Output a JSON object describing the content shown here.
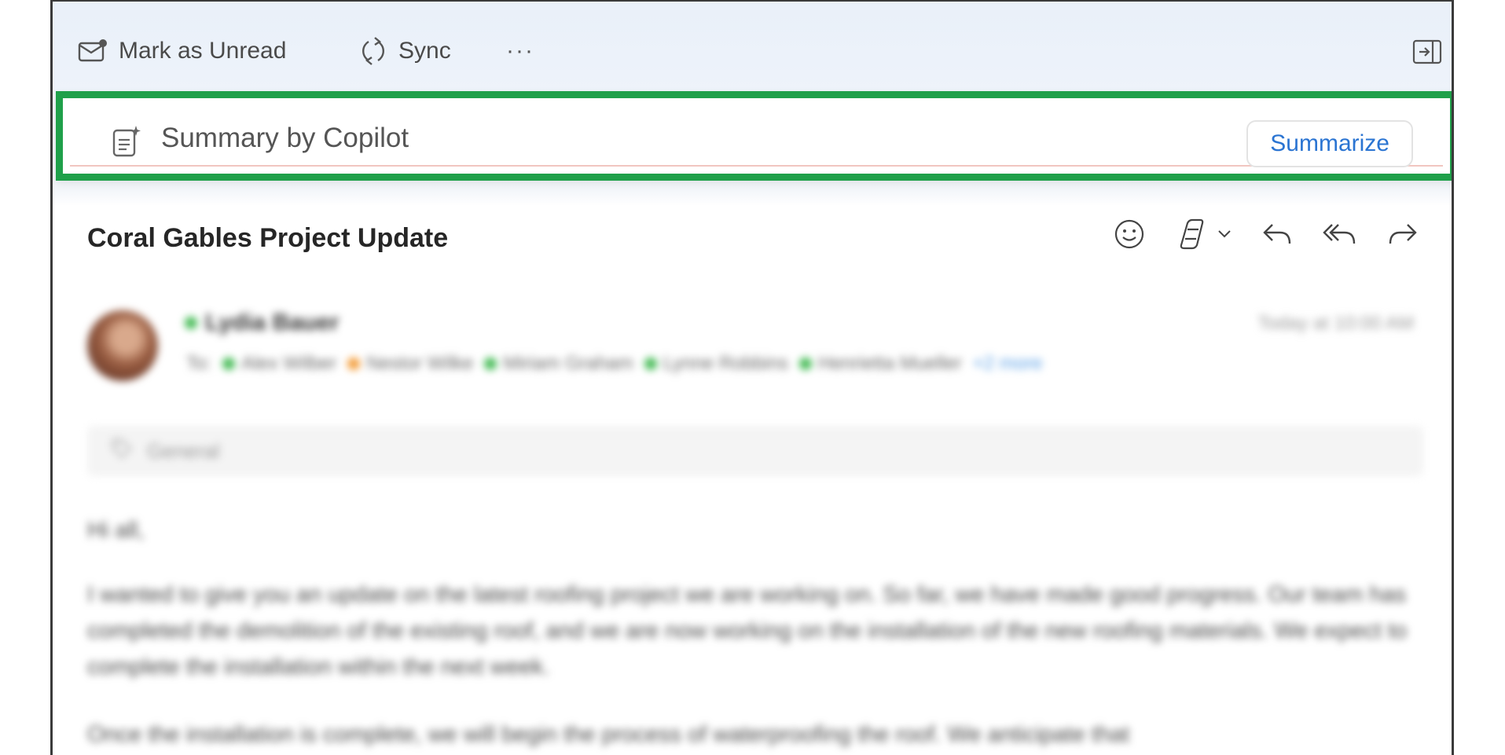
{
  "toolbar": {
    "mark_unread_label": "Mark as Unread",
    "sync_label": "Sync",
    "more_label": "···"
  },
  "copilot": {
    "label": "Summary by Copilot",
    "summarize_label": "Summarize",
    "highlight_color": "#1fa04a"
  },
  "message": {
    "subject": "Coral Gables Project Update",
    "sender": "Lydia Bauer",
    "timestamp": "Today at 10:00 AM",
    "to_label": "To:",
    "recipients": [
      {
        "name": "Alex Wilber",
        "status": "green"
      },
      {
        "name": "Nestor Wilke",
        "status": "orange"
      },
      {
        "name": "Miriam Graham",
        "status": "green"
      },
      {
        "name": "Lynne Robbins",
        "status": "green"
      },
      {
        "name": "Henrietta Mueller",
        "status": "green"
      }
    ],
    "more_recipients": "+2 more",
    "category": "General",
    "body": {
      "greeting": "Hi all,",
      "paragraph1": "I wanted to give you an update on the latest roofing project we are working on. So far, we have made good progress. Our team has completed the demolition of the existing roof, and we are now working on the installation of the new roofing materials. We expect to complete the installation within the next week.",
      "paragraph2": "Once the installation is complete, we will begin the process of waterproofing the roof. We anticipate that"
    }
  },
  "colors": {
    "accent_blue": "#2a74d2",
    "status_green": "#3fb950",
    "status_orange": "#f39b36"
  }
}
